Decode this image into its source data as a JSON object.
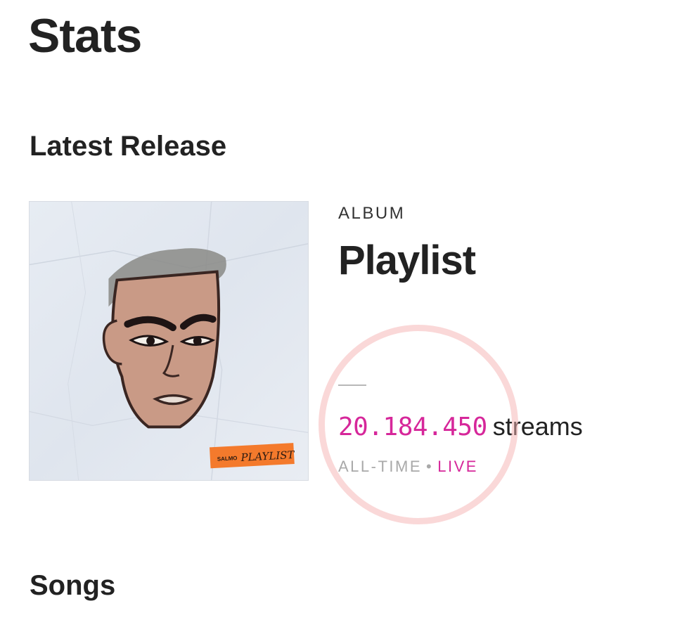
{
  "page": {
    "title": "Stats"
  },
  "latest_release": {
    "heading": "Latest Release",
    "type": "ALBUM",
    "name": "Playlist",
    "cover_image": {
      "description": "hand-drawn face album art",
      "label_artist": "SALMO",
      "label_title": "PLAYLIST"
    },
    "streams": {
      "count": "20.184.450",
      "unit": "streams",
      "period": "ALL-TIME",
      "separator": "•",
      "live": "LIVE"
    }
  },
  "songs": {
    "heading": "Songs"
  },
  "colors": {
    "accent": "#d6279a",
    "muted": "#a9a9a9",
    "text": "#222222",
    "highlight_ring": "#f6b2b2"
  }
}
